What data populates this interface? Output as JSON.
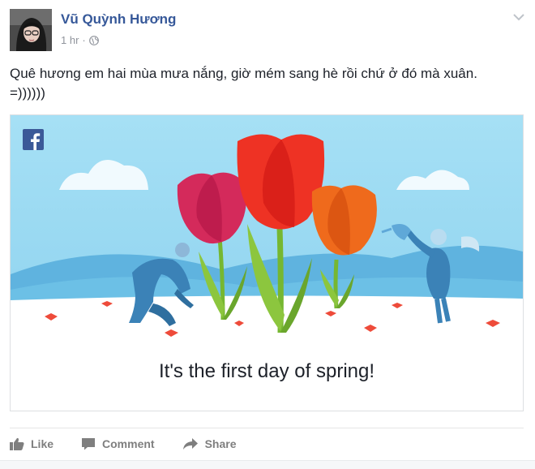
{
  "author": {
    "name": "Vũ Quỳnh Hương"
  },
  "meta": {
    "time": "1 hr",
    "separator": "·"
  },
  "post": {
    "line1": "Quê hương em hai mùa mưa nắng, giờ mém sang hè rồi chứ ở đó mà xuân.",
    "line2": "=))))))"
  },
  "card": {
    "caption": "It's the first day of spring!"
  },
  "actions": {
    "like": "Like",
    "comment": "Comment",
    "share": "Share"
  },
  "colors": {
    "name_link": "#365899",
    "sky": "#9fdcf3",
    "tulip_pink": "#d42a5b",
    "tulip_red": "#ee3224",
    "tulip_orange": "#ef6a1c",
    "figure_blue": "#3b82b7"
  },
  "icons": [
    "globe-icon",
    "chevron-down-icon",
    "facebook-logo-icon",
    "like-icon",
    "comment-icon",
    "share-icon"
  ]
}
